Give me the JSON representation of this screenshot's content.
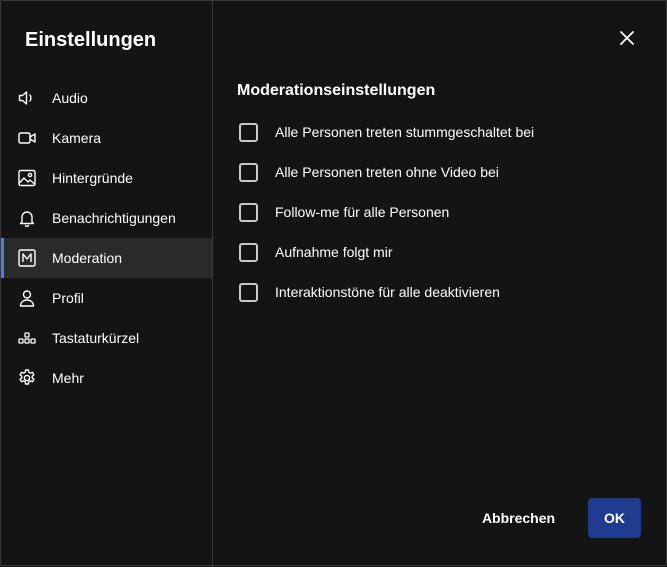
{
  "dialog": {
    "title": "Einstellungen",
    "close_icon": "close-icon"
  },
  "sidebar": {
    "active_index": 4,
    "items": [
      {
        "label": "Audio",
        "icon": "speaker-icon"
      },
      {
        "label": "Kamera",
        "icon": "camera-icon"
      },
      {
        "label": "Hintergründe",
        "icon": "image-icon"
      },
      {
        "label": "Benachrichtigungen",
        "icon": "bell-icon"
      },
      {
        "label": "Moderation",
        "icon": "moderation-icon"
      },
      {
        "label": "Profil",
        "icon": "person-icon"
      },
      {
        "label": "Tastaturkürzel",
        "icon": "shortcuts-icon"
      },
      {
        "label": "Mehr",
        "icon": "gear-icon"
      }
    ]
  },
  "main": {
    "section_title": "Moderationseinstellungen",
    "options": [
      {
        "label": "Alle Personen treten stummgeschaltet bei",
        "checked": false
      },
      {
        "label": "Alle Personen treten ohne Video bei",
        "checked": false
      },
      {
        "label": "Follow-me für alle Personen",
        "checked": false
      },
      {
        "label": "Aufnahme folgt mir",
        "checked": false
      },
      {
        "label": "Interaktionstöne für alle deaktivieren",
        "checked": false
      }
    ]
  },
  "footer": {
    "cancel_label": "Abbrechen",
    "ok_label": "OK"
  },
  "colors": {
    "background": "#141414",
    "active_item": "#2a2a2a",
    "accent": "#4b7cf1",
    "primary_button": "#1f3b8f",
    "border": "#3a3a3a"
  }
}
